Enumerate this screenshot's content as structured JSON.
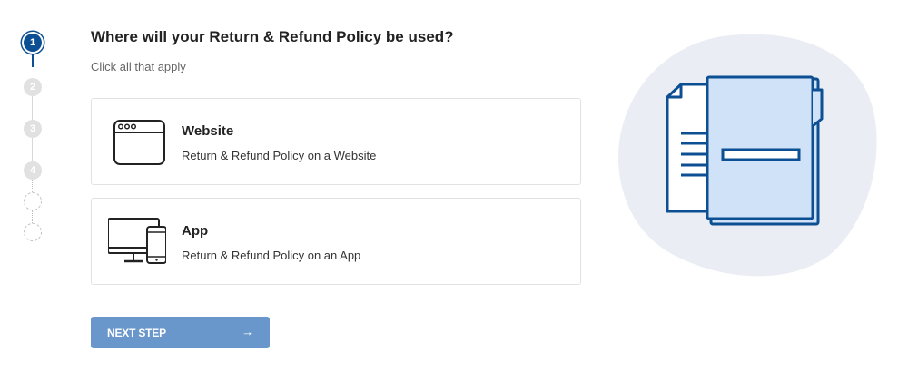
{
  "stepper": {
    "steps": [
      {
        "number": "1",
        "state": "current"
      },
      {
        "number": "2",
        "state": "upcoming"
      },
      {
        "number": "3",
        "state": "upcoming"
      },
      {
        "number": "4",
        "state": "upcoming"
      },
      {
        "number": "",
        "state": "future"
      },
      {
        "number": "",
        "state": "future"
      }
    ]
  },
  "question": {
    "title": "Where will your Return & Refund Policy be used?",
    "subtitle": "Click all that apply"
  },
  "options": [
    {
      "icon": "browser-window-icon",
      "title": "Website",
      "description": "Return & Refund Policy on a Website"
    },
    {
      "icon": "desktop-and-phone-icon",
      "title": "App",
      "description": "Return & Refund Policy on an App"
    }
  ],
  "next_button": {
    "label": "NEXT STEP",
    "arrow": "→"
  },
  "illustration": {
    "icon": "document-folder-icon"
  },
  "colors": {
    "primary": "#0c4f92",
    "button": "#6a97cb",
    "illustration_blob": "#eaeef4",
    "illustration_fill": "#cfe2f8",
    "card_border": "#e2e2e2"
  }
}
